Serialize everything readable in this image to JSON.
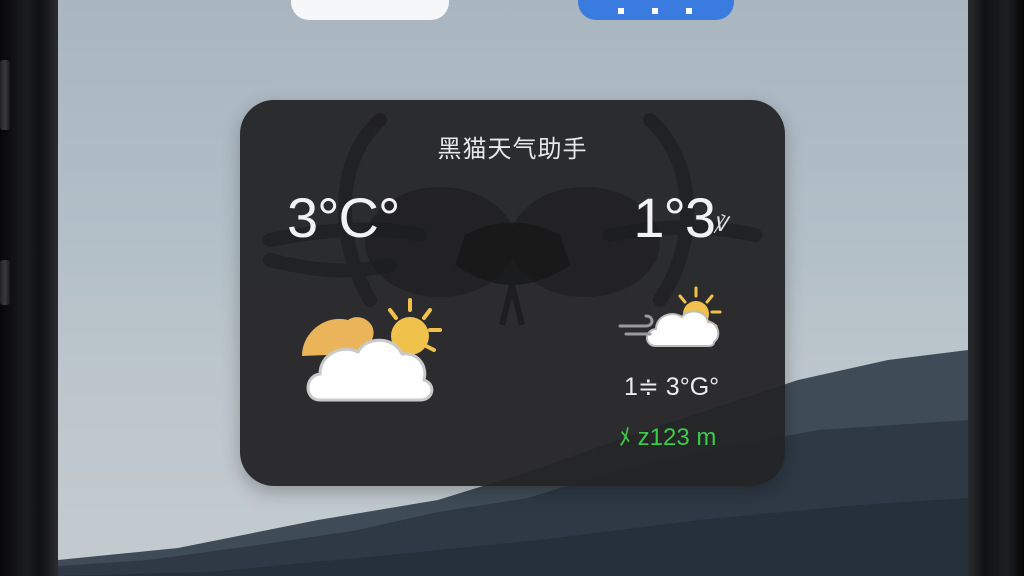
{
  "widget": {
    "title": "黑猫天气助手",
    "current_temp": "3°C°",
    "right_temp": "1°3",
    "right_temp_unit": "℣",
    "range_text": "1≑ 3°G°",
    "altitude_text": "ﾒ z123 m",
    "altitude_color": "#3ccb4a",
    "main_icon": "partly-cloudy-icon",
    "secondary_icon": "windy-partly-cloudy-icon"
  },
  "top_apps": [
    {
      "name": "white-app-icon",
      "color": "#f6f7f8"
    },
    {
      "name": "blue-app-icon",
      "color": "#3a7be0"
    }
  ]
}
